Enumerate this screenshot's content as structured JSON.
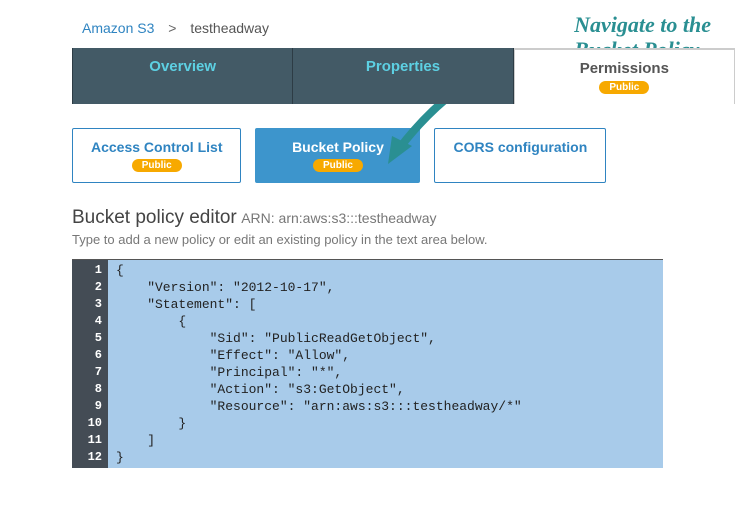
{
  "breadcrumb": {
    "root": "Amazon S3",
    "sep": ">",
    "current": "testheadway"
  },
  "tabs": {
    "overview": "Overview",
    "properties": "Properties",
    "permissions": "Permissions",
    "public_badge": "Public"
  },
  "subtabs": {
    "acl": "Access Control List",
    "bucket_policy": "Bucket Policy",
    "cors": "CORS configuration",
    "public_badge": "Public"
  },
  "editor_header": {
    "title": "Bucket policy editor",
    "arn": "ARN: arn:aws:s3:::testheadway",
    "subtitle": "Type to add a new policy or edit an existing policy in the text area below."
  },
  "code": {
    "lines": [
      "1",
      "2",
      "3",
      "4",
      "5",
      "6",
      "7",
      "8",
      "9",
      "10",
      "11",
      "12"
    ],
    "text": "{\n    \"Version\": \"2012-10-17\",\n    \"Statement\": [\n        {\n            \"Sid\": \"PublicReadGetObject\",\n            \"Effect\": \"Allow\",\n            \"Principal\": \"*\",\n            \"Action\": \"s3:GetObject\",\n            \"Resource\": \"arn:aws:s3:::testheadway/*\"\n        }\n    ]\n}"
  },
  "annotation": {
    "line1": "Navigate to the",
    "line2": "Bucket Policy"
  }
}
